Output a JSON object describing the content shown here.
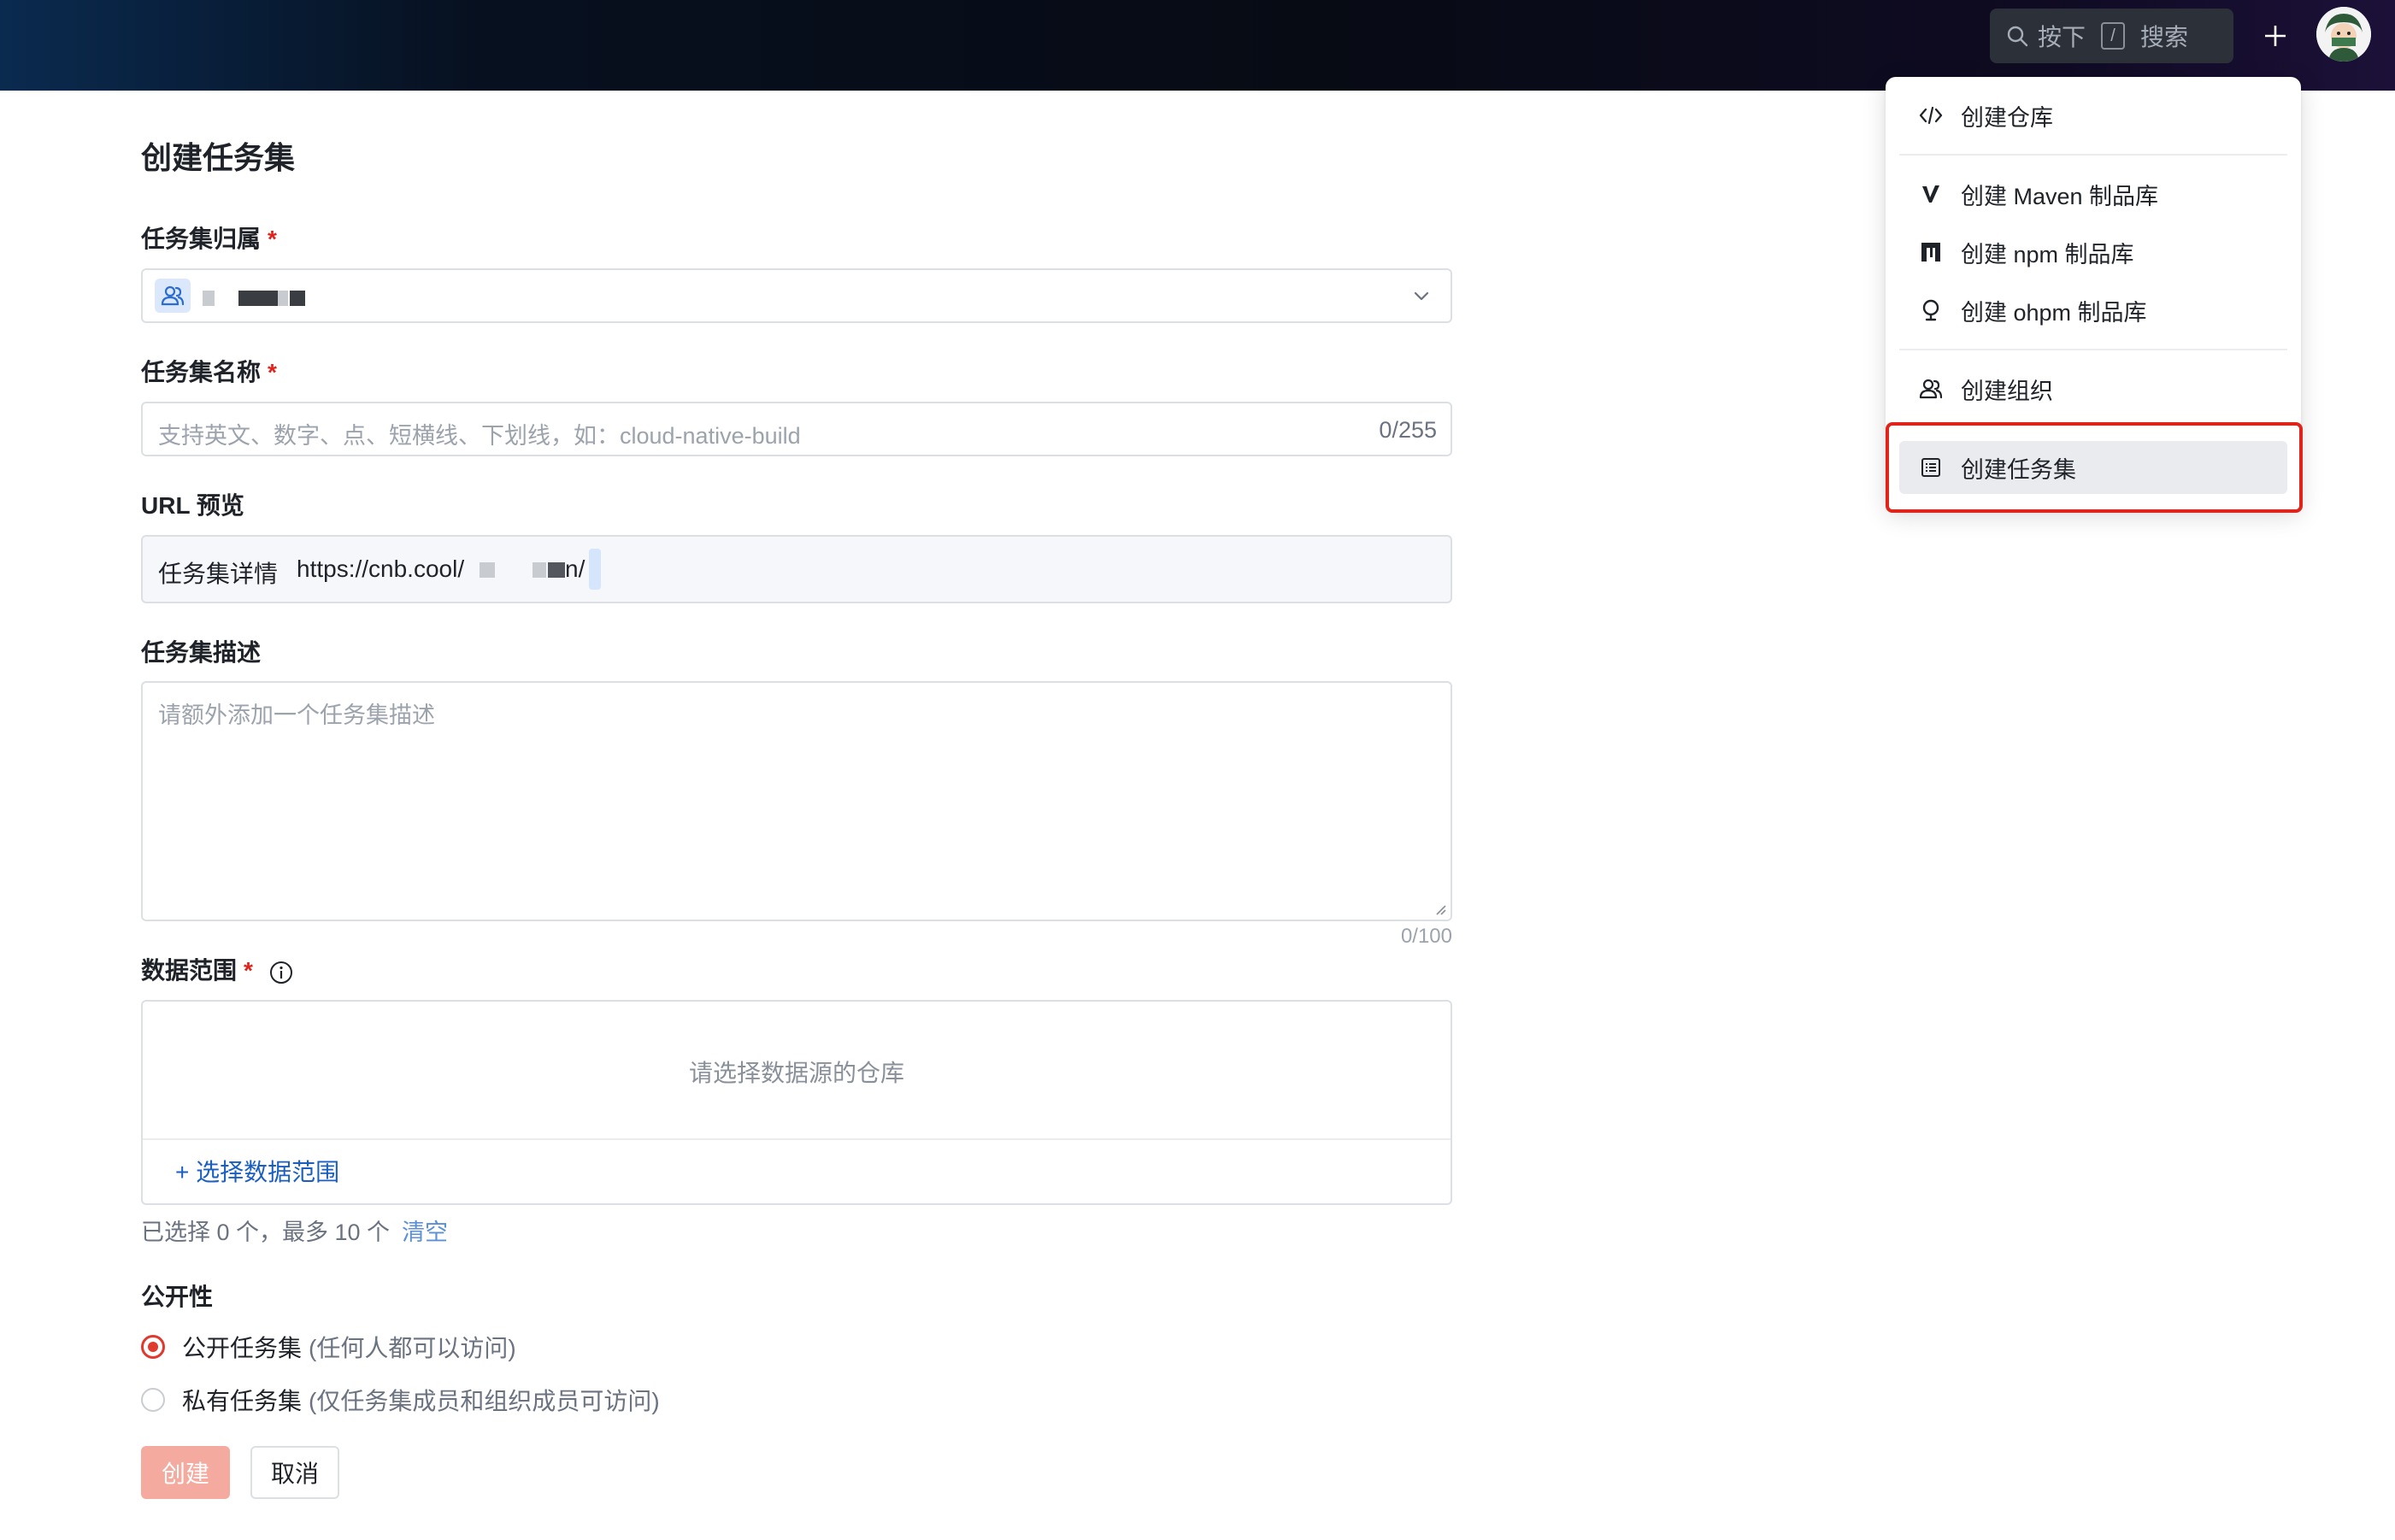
{
  "topbar": {
    "search_prefix": "按下",
    "search_key": "/",
    "search_suffix": "搜索"
  },
  "menu": {
    "items": [
      {
        "label": "创建仓库",
        "icon": "code-icon"
      },
      {
        "label": "创建 Maven 制品库",
        "icon": "maven-icon"
      },
      {
        "label": "创建 npm 制品库",
        "icon": "npm-icon"
      },
      {
        "label": "创建 ohpm 制品库",
        "icon": "ohpm-icon"
      },
      {
        "label": "创建组织",
        "icon": "organization-icon"
      },
      {
        "label": "创建任务集",
        "icon": "list-icon"
      }
    ],
    "active_index": 5,
    "highlight_color": "#e0241b"
  },
  "form": {
    "title": "创建任务集",
    "owner": {
      "label": "任务集归属",
      "required": "*"
    },
    "name": {
      "label": "任务集名称",
      "required": "*",
      "placeholder": "支持英文、数字、点、短横线、下划线，如：cloud-native-build",
      "count": "0/255"
    },
    "url": {
      "label": "URL 预览",
      "key": "任务集详情",
      "value": "https://cnb.cool/",
      "value_end": "n/"
    },
    "description": {
      "label": "任务集描述",
      "placeholder": "请额外添加一个任务集描述",
      "count": "0/100"
    },
    "range": {
      "label": "数据范围",
      "required": "*",
      "empty": "请选择数据源的仓库",
      "add": "+ 选择数据范围",
      "hint": "已选择 0 个，最多 10 个",
      "clear": "清空"
    },
    "visibility": {
      "label": "公开性",
      "options": [
        {
          "label": "公开任务集",
          "desc": "(任何人都可以访问)",
          "selected": true
        },
        {
          "label": "私有任务集",
          "desc": "(仅任务集成员和组织成员可访问)",
          "selected": false
        }
      ]
    },
    "submit": "创建",
    "cancel": "取消",
    "accent": "#e0392d"
  }
}
